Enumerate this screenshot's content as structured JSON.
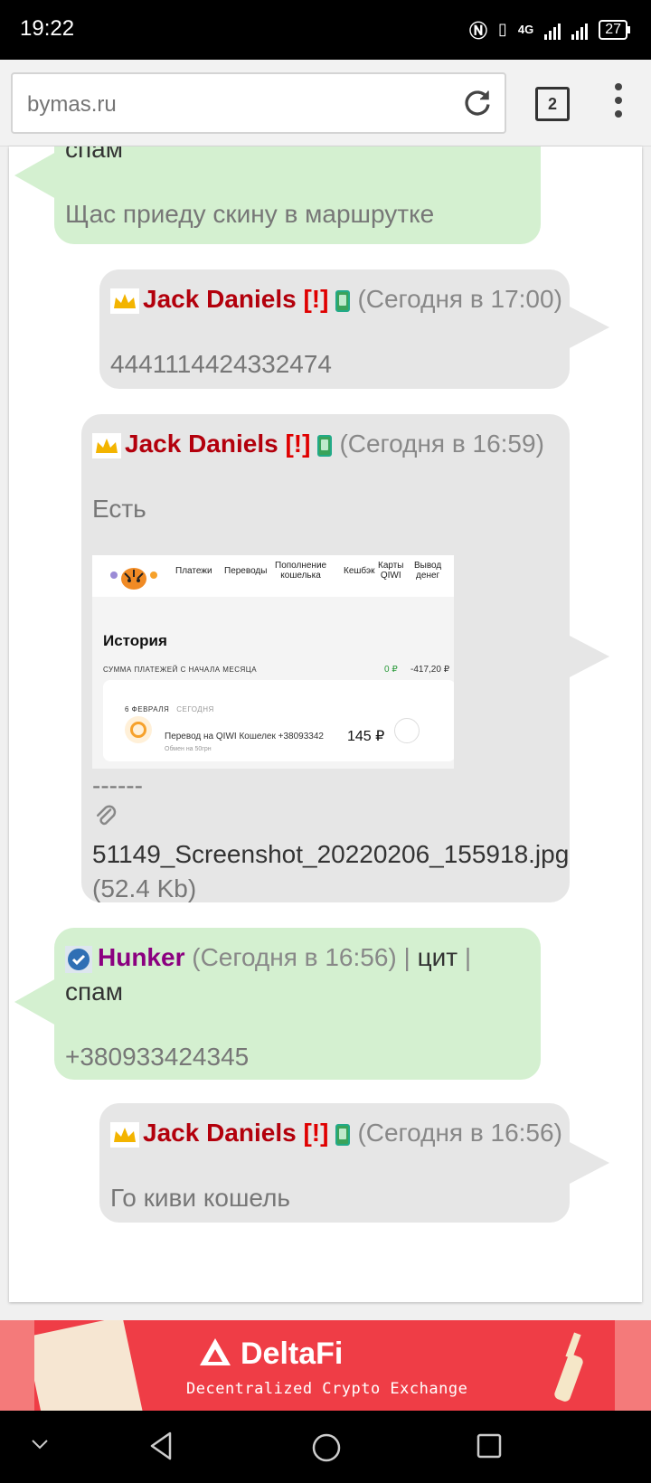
{
  "status_bar": {
    "time": "19:22",
    "network": "4G",
    "battery": "27"
  },
  "browser": {
    "url": "bymas.ru",
    "tab_count": "2"
  },
  "messages": {
    "m1": {
      "line1": "спам",
      "text": "Щас приеду скину в маршрутке"
    },
    "m2": {
      "name": "Jack Daniels",
      "excl": "[!]",
      "time": "(Сегодня в 17:00)",
      "text": "4441114424332474"
    },
    "m3": {
      "name": "Jack Daniels",
      "excl": "[!]",
      "time": "(Сегодня в 16:59)",
      "text": "Есть",
      "separator": "------",
      "filename": "51149_Screenshot_20220206_155918.jpg",
      "filesize": "(52.4 Kb)"
    },
    "m4": {
      "name": "Hunker",
      "time": "(Сегодня в 16:56)",
      "sep1": "|",
      "cit": "цит",
      "sep2": "|",
      "spam": "спам",
      "text": "+380933424345"
    },
    "m5": {
      "name": "Jack Daniels",
      "excl": "[!]",
      "time": "(Сегодня в 16:56)",
      "text": "Го киви кошель"
    }
  },
  "qiwi": {
    "nav": [
      "Платежи",
      "Переводы",
      "Пополнение\nкошелька",
      "Кешбэк",
      "Карты\nQIWI",
      "Вывод\nденег"
    ],
    "title": "История",
    "subtitle": "СУММА ПЛАТЕЖЕЙ С НАЧАЛА МЕСЯЦА",
    "zero": "0 ₽",
    "amount": "-417,20 ₽",
    "date": "6 ФЕВРАЛЯ",
    "today": "СЕГОДНЯ",
    "tx": "Перевод на QIWI Кошелек +38093342",
    "tx_note": "Обмен на 50грн",
    "price": "145 ₽"
  },
  "ad": {
    "brand": "DeltaFi",
    "tagline": "Decentralized Crypto Exchange"
  }
}
